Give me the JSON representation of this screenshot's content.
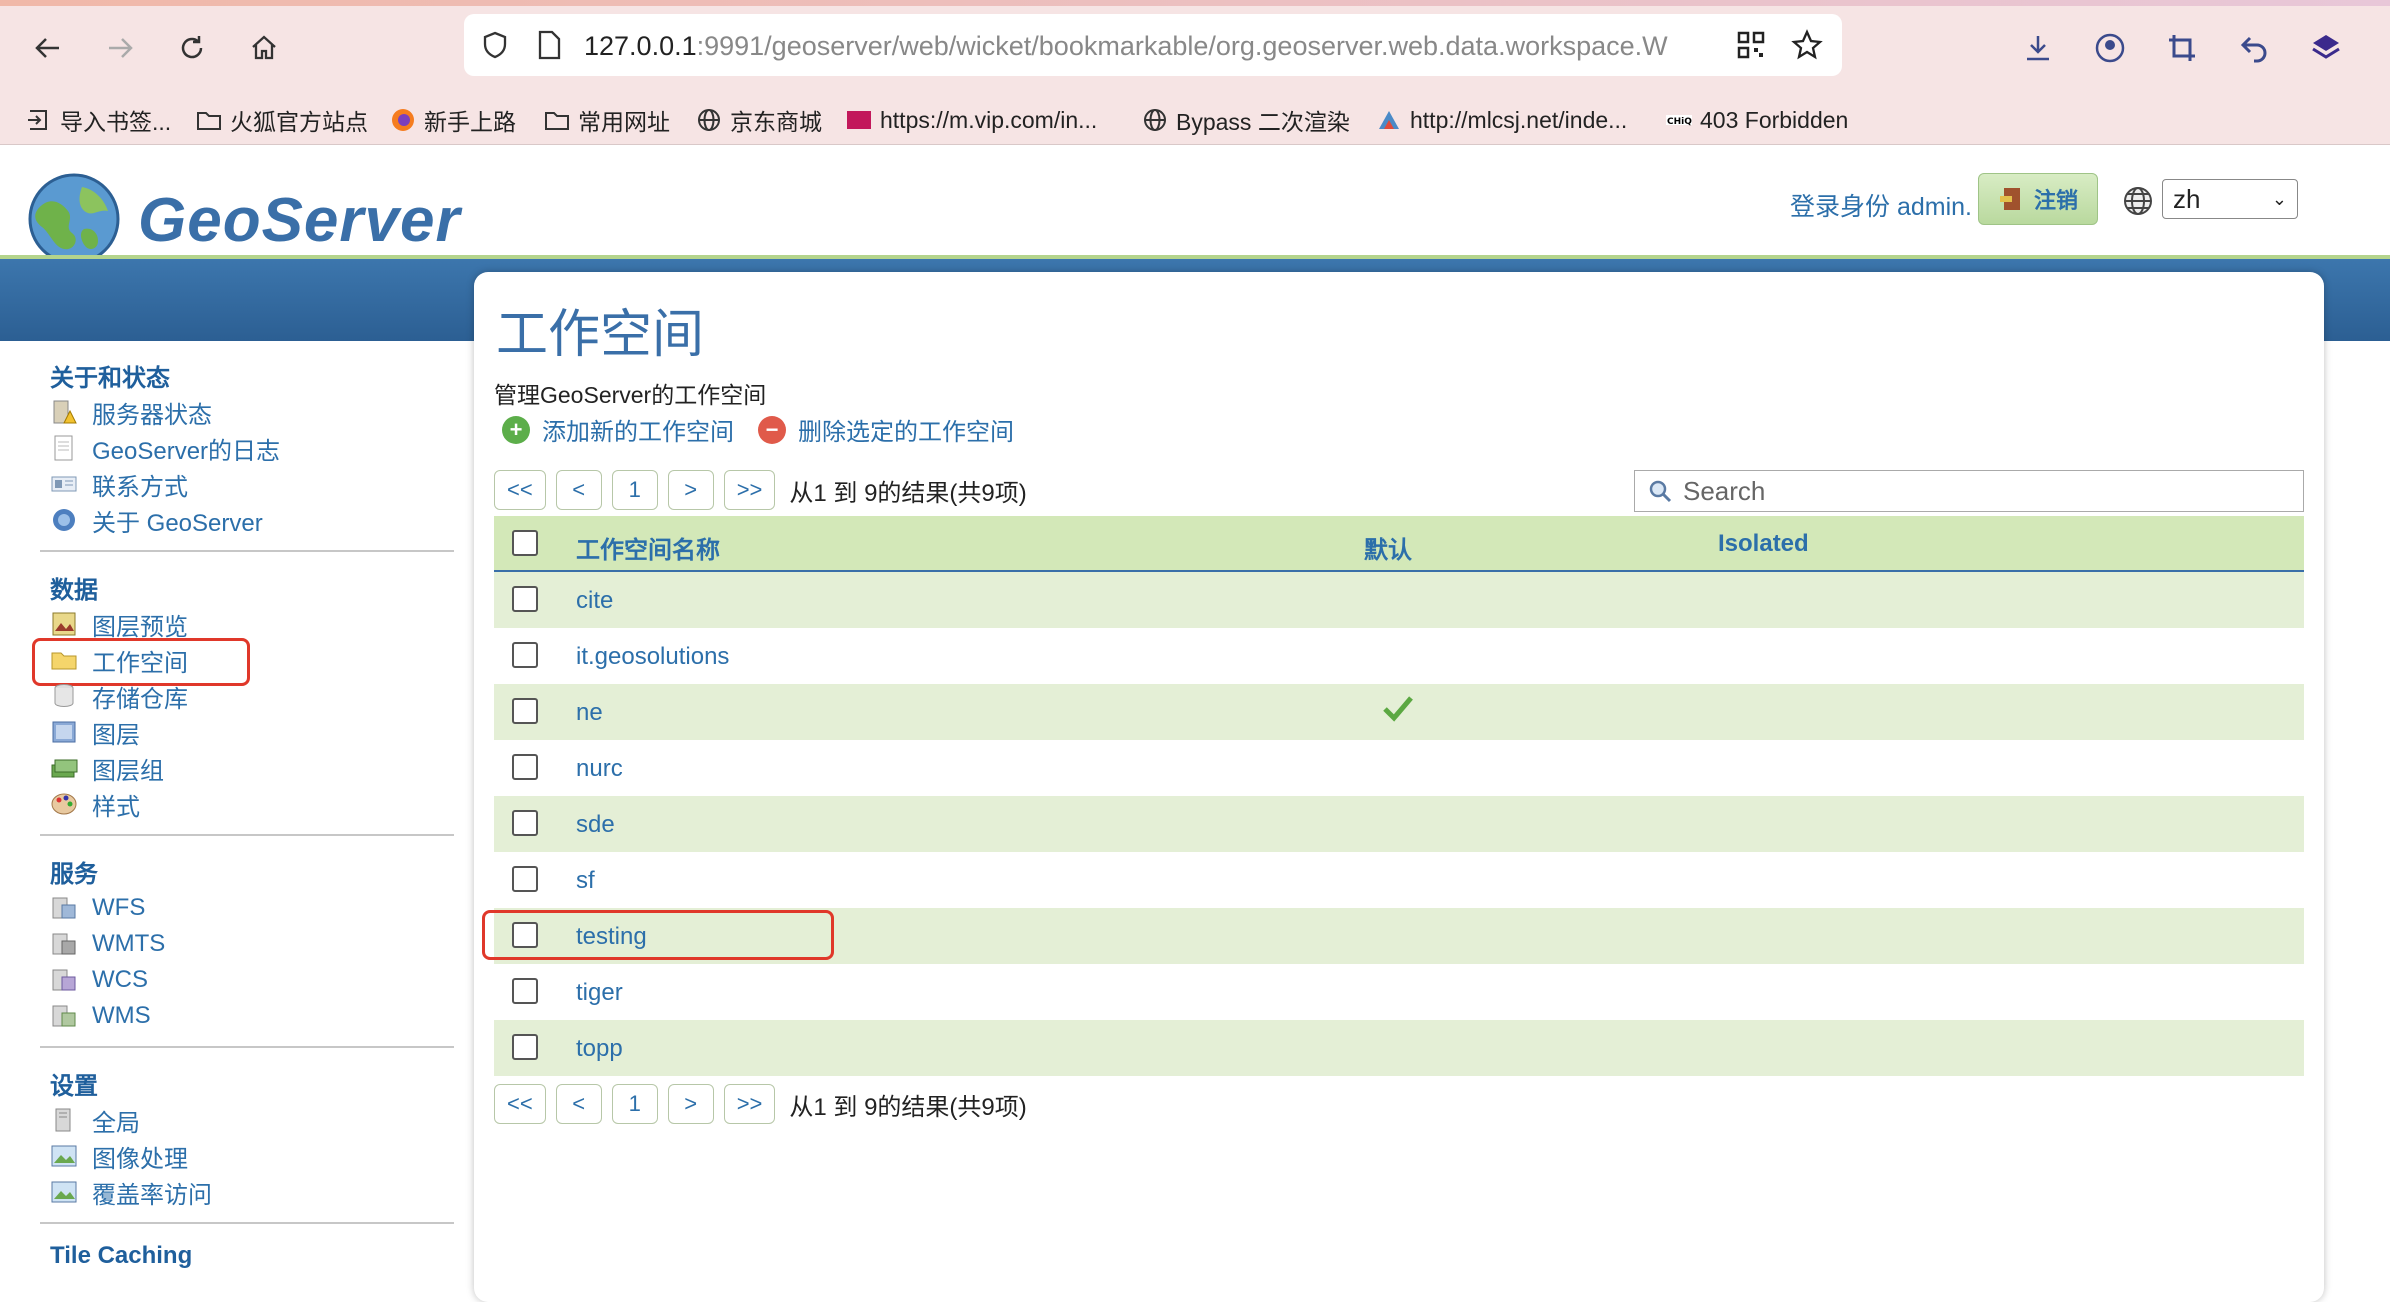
{
  "browser": {
    "url_host": "127.0.0.1",
    "url_rest": ":9991/geoserver/web/wicket/bookmarkable/org.geoserver.web.data.workspace.W",
    "bookmarks": [
      {
        "label": "导入书签...",
        "icon": "import-icon"
      },
      {
        "label": "火狐官方站点",
        "icon": "folder-icon"
      },
      {
        "label": "新手上路",
        "icon": "firefox-icon"
      },
      {
        "label": "常用网址",
        "icon": "folder-icon"
      },
      {
        "label": "京东商城",
        "icon": "globe-icon"
      },
      {
        "label": "https://m.vip.com/in...",
        "icon": "vip-icon"
      },
      {
        "label": "Bypass 二次渲染",
        "icon": "globe-icon"
      },
      {
        "label": "http://mlcsj.net/inde...",
        "icon": "site-icon"
      },
      {
        "label": "403 Forbidden",
        "icon": "chiq-icon"
      }
    ]
  },
  "header": {
    "logo_text": "GeoServer",
    "login_text": "登录身份 admin.",
    "logout_label": "注销",
    "language": "zh"
  },
  "sidebar": {
    "sections": [
      {
        "title": "关于和状态",
        "items": [
          {
            "label": "服务器状态",
            "icon": "server-status-icon"
          },
          {
            "label": "GeoServer的日志",
            "icon": "log-icon"
          },
          {
            "label": "联系方式",
            "icon": "contact-icon"
          },
          {
            "label": "关于 GeoServer",
            "icon": "about-icon"
          }
        ]
      },
      {
        "title": "数据",
        "items": [
          {
            "label": "图层预览",
            "icon": "layer-preview-icon"
          },
          {
            "label": "工作空间",
            "icon": "workspace-folder-icon"
          },
          {
            "label": "存储仓库",
            "icon": "store-icon"
          },
          {
            "label": "图层",
            "icon": "layer-icon"
          },
          {
            "label": "图层组",
            "icon": "layer-group-icon"
          },
          {
            "label": "样式",
            "icon": "style-icon"
          }
        ]
      },
      {
        "title": "服务",
        "items": [
          {
            "label": "WFS",
            "icon": "service-icon"
          },
          {
            "label": "WMTS",
            "icon": "service-icon"
          },
          {
            "label": "WCS",
            "icon": "service-icon"
          },
          {
            "label": "WMS",
            "icon": "service-icon"
          }
        ]
      },
      {
        "title": "设置",
        "items": [
          {
            "label": "全局",
            "icon": "global-icon"
          },
          {
            "label": "图像处理",
            "icon": "image-processing-icon"
          },
          {
            "label": "覆盖率访问",
            "icon": "coverage-access-icon"
          }
        ]
      },
      {
        "title": "Tile Caching",
        "items": []
      }
    ]
  },
  "main": {
    "title": "工作空间",
    "description": "管理GeoServer的工作空间",
    "add_label": "添加新的工作空间",
    "remove_label": "删除选定的工作空间",
    "pager": {
      "first": "<<",
      "prev": "<",
      "page": "1",
      "next": ">",
      "last": ">>",
      "info": "从1 到 9的结果(共9项)"
    },
    "search_placeholder": "Search",
    "columns": [
      "工作空间名称",
      "默认",
      "Isolated"
    ],
    "rows": [
      {
        "name": "cite",
        "default": false
      },
      {
        "name": "it.geosolutions",
        "default": false
      },
      {
        "name": "ne",
        "default": true
      },
      {
        "name": "nurc",
        "default": false
      },
      {
        "name": "sde",
        "default": false
      },
      {
        "name": "sf",
        "default": false
      },
      {
        "name": "testing",
        "default": false
      },
      {
        "name": "tiger",
        "default": false
      },
      {
        "name": "topp",
        "default": false
      }
    ]
  },
  "colors": {
    "link": "#2c6faa",
    "row_alt": "#e4efd6",
    "header_green": "#d3e8b8",
    "highlight": "#e0382a"
  }
}
